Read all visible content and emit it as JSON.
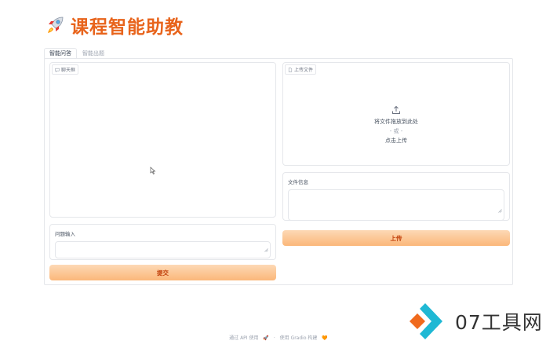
{
  "app": {
    "title": "课程智能助教",
    "accent_color": "#e8641c",
    "title_icon": "rocket-icon"
  },
  "tabs": [
    {
      "label": "智能问答",
      "active": true
    },
    {
      "label": "智能出题",
      "active": false
    }
  ],
  "chatbot": {
    "label": "聊天框",
    "icon": "chat-icon"
  },
  "upload": {
    "label": "上传文件",
    "icon": "file-icon",
    "drop_text": "将文件拖放到此处",
    "or_text": "- 或 -",
    "click_text": "点击上传",
    "button_label": "上传"
  },
  "file_info": {
    "label": "文件信息",
    "value": ""
  },
  "question": {
    "label": "问题输入",
    "value": ""
  },
  "submit": {
    "label": "提交"
  },
  "footer": {
    "api_text": "通过 API 使用",
    "separator": "·",
    "built_text": "使用 Gradio 构建"
  },
  "watermark": {
    "text": "07工具网"
  }
}
